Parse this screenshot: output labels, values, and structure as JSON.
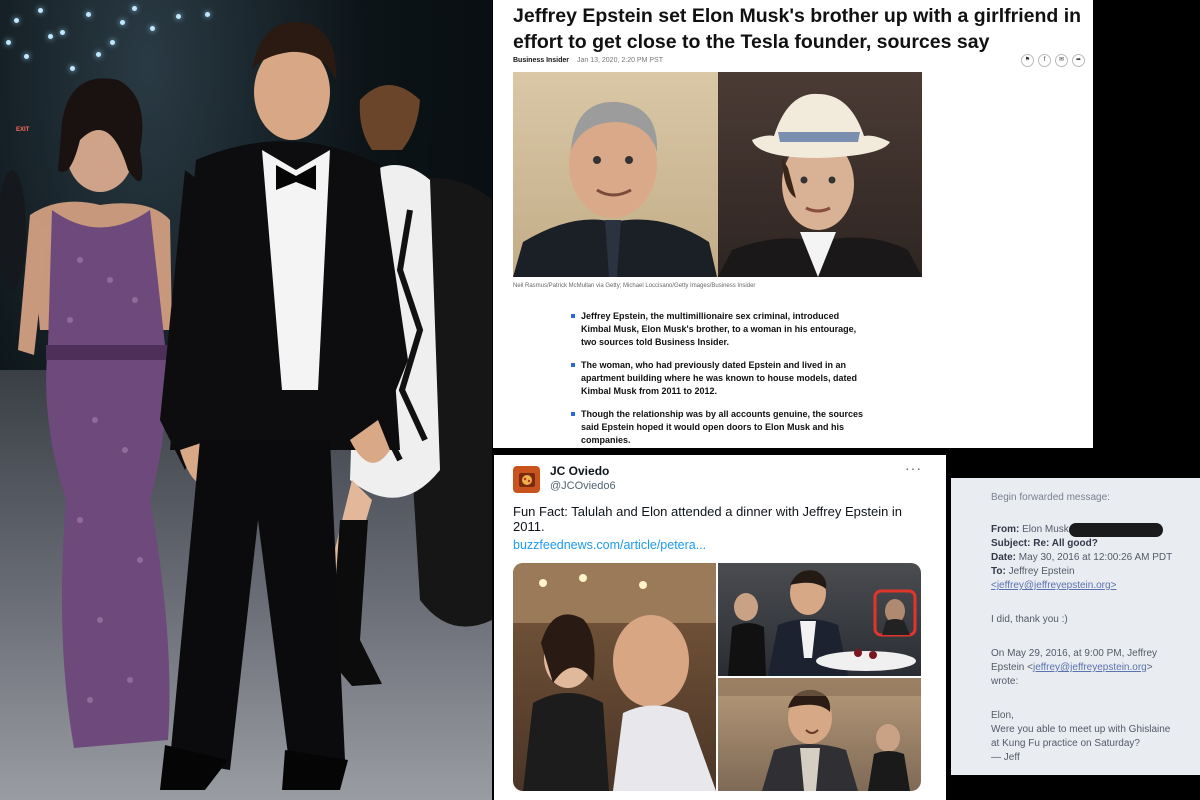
{
  "event_photo": {
    "exit_sign": "EXIT"
  },
  "article": {
    "headline": "Jeffrey Epstein set Elon Musk's brother up with a girlfriend in effort to get close to the Tesla founder, sources say",
    "publication": "Business Insider",
    "date": "Jan 13, 2020, 2:20 PM PST",
    "share_icons": [
      "bookmark-icon",
      "facebook-icon",
      "email-icon",
      "share-icon"
    ],
    "photo_caption": "Neil Rasmus/Patrick McMullan via Getty; Michael Loccisano/Getty Images/Business Insider",
    "bullets": [
      "Jeffrey Epstein, the multimillionaire sex criminal, introduced Kimbal Musk, Elon Musk's brother, to a woman in his entourage, two sources told Business Insider.",
      "The woman, who had previously dated Epstein and lived in an apartment building where he was known to house models, dated Kimbal Musk from 2011 to 2012.",
      "Though the relationship was by all accounts genuine, the sources said Epstein hoped it would open doors to Elon Musk and his companies."
    ],
    "accent_color": "#2a6ad6"
  },
  "tweet": {
    "name": "JC Oviedo",
    "handle": "@JCOviedo6",
    "more_label": "···",
    "text": "Fun Fact: Talulah and Elon attended a dinner with Jeffrey Epstein in 2011.",
    "link": "buzzfeednews.com/article/petera...",
    "link_color": "#1d9bf0",
    "highlight_color": "#e0352b"
  },
  "email": {
    "forwarded": "Begin forwarded message:",
    "from_label": "From:",
    "from_value": "Elon Musk",
    "subject_label": "Subject:",
    "subject_value": "Re: All good?",
    "date_label": "Date:",
    "date_value": "May 30, 2016 at 12:00:26 AM PDT",
    "to_label": "To:",
    "to_value": "Jeffrey Epstein",
    "to_email": "<jeffrey@jeffreyepstein.org>",
    "reply": "I did, thank you :)",
    "quote_line1": "On May 29, 2016, at 9:00 PM, Jeffrey",
    "quote_line2_name": "Epstein <",
    "quote_line2_email": "jeffrey@jeffreyepstein.org",
    "quote_line2_end": ">",
    "quote_line3": "wrote:",
    "body_line1": "Elon,",
    "body_line2": "Were you able to meet up with Ghislaine",
    "body_line3": "at Kung Fu practice on Saturday?",
    "body_line4": "— Jeff"
  }
}
